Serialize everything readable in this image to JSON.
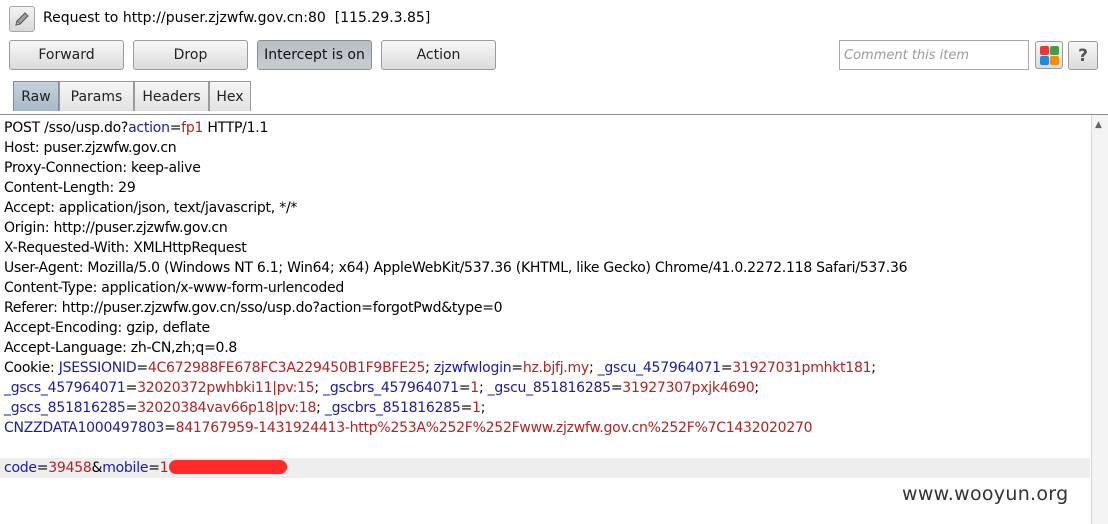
{
  "request": {
    "title": "Request to http://puser.zjzwfw.gov.cn:80",
    "ip": "[115.29.3.85]"
  },
  "toolbar": {
    "forward_label": "Forward",
    "drop_label": "Drop",
    "intercept_label": "Intercept is on",
    "action_label": "Action",
    "comment_placeholder": "Comment this item",
    "comment_value": "",
    "help_label": "?"
  },
  "icons": {
    "edit": "pencil-icon",
    "highlight": "color-grid-icon",
    "help": "help-icon"
  },
  "highlight_colors": [
    "#e53935",
    "#43a047",
    "#1e88e5",
    "#fb8c00"
  ],
  "tabs": [
    {
      "label": "Raw",
      "active": true
    },
    {
      "label": "Params",
      "active": false
    },
    {
      "label": "Headers",
      "active": false
    },
    {
      "label": "Hex",
      "active": false
    }
  ],
  "http": {
    "request_line": {
      "method": "POST ",
      "path": "/sso/usp.do?",
      "param_key": "action",
      "eq": "=",
      "param_value": "fp1",
      "version": " HTTP/1.1"
    },
    "headers": [
      "Host: puser.zjzwfw.gov.cn",
      "Proxy-Connection: keep-alive",
      "Content-Length: 29",
      "Accept: application/json, text/javascript, */*",
      "Origin: http://puser.zjzwfw.gov.cn",
      "X-Requested-With: XMLHttpRequest",
      "User-Agent: Mozilla/5.0 (Windows NT 6.1; Win64; x64) AppleWebKit/537.36 (KHTML, like Gecko) Chrome/41.0.2272.118 Safari/537.36",
      "Content-Type: application/x-www-form-urlencoded",
      "Referer: http://puser.zjzwfw.gov.cn/sso/usp.do?action=forgotPwd&type=0",
      "Accept-Encoding: gzip, deflate",
      "Accept-Language: zh-CN,zh;q=0.8"
    ],
    "cookie": {
      "label": "Cookie: ",
      "pairs_line1": [
        {
          "k": "JSESSIONID",
          "v": "4C672988FE678FC3A229450B1F9BFE25"
        },
        {
          "k": "zjzwfwlogin",
          "v": "hz.bjfj.my"
        },
        {
          "k": "_gscu_457964071",
          "v": "31927031pmhkt181"
        }
      ],
      "pairs_line2": [
        {
          "k": "_gscs_457964071",
          "v": "32020372pwhbki11|pv:15"
        },
        {
          "k": "_gscbrs_457964071",
          "v": "1"
        },
        {
          "k": "_gscu_851816285",
          "v": "31927307pxjk4690"
        }
      ],
      "pairs_line3": [
        {
          "k": "_gscs_851816285",
          "v": "32020384vav66p18|pv:18"
        },
        {
          "k": "_gscbrs_851816285",
          "v": "1"
        }
      ],
      "pairs_line4": [
        {
          "k": "CNZZDATA1000497803",
          "v": "841767959-1431924413-http%253A%252F%252Fwww.zjzwfw.gov.cn%252F%7C1432020270"
        }
      ]
    },
    "body": {
      "k1": "code",
      "v1": "39458",
      "amp": "&",
      "k2": "mobile",
      "v2_visible": "1"
    }
  },
  "watermark": "www.wooyun.org"
}
